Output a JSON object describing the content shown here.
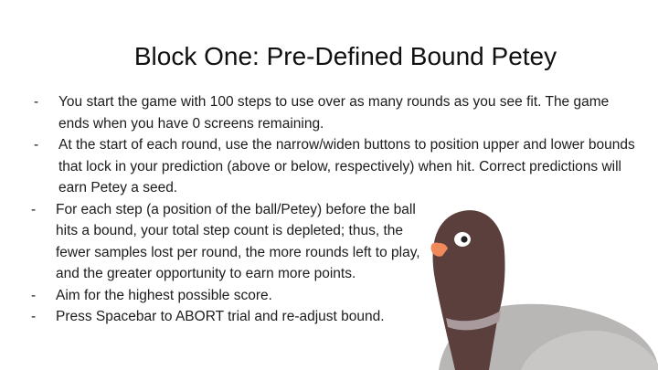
{
  "slide": {
    "title": "Block One: Pre-Defined Bound Petey",
    "bullet_marker": "-",
    "bullets": [
      "You start the game with 100 steps to use over as many rounds as you see fit. The game ends when you have 0 screens remaining.",
      "At the start of each round, use the narrow/widen buttons to position upper and lower bounds that lock in your prediction (above or below, respectively) when hit. Correct predictions will earn Petey a seed.",
      "For each step (a position of the ball/Petey) before the ball hits a bound, your total step count is depleted; thus, the fewer samples lost per round, the more rounds left to play, and the greater opportunity to earn more points.",
      "Aim for the highest possible score.",
      "Press Spacebar to ABORT trial and re-adjust bound."
    ]
  },
  "pigeon": {
    "icon": "pigeon-illustration-icon",
    "head_color": "#5a3f3c",
    "body_color": "#b9b6b6",
    "breast_color": "#a99a9d",
    "beak_color": "#f08a5a",
    "eye_color": "#ffffff"
  }
}
